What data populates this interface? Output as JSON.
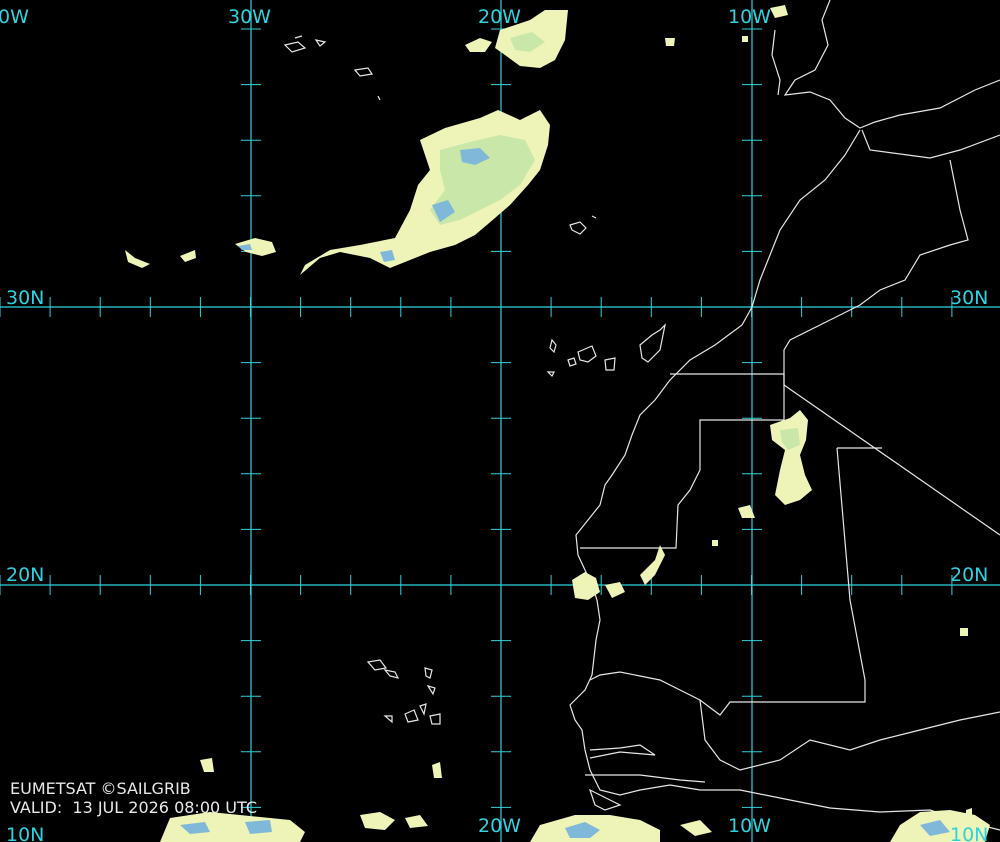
{
  "map": {
    "longitude_labels": {
      "w40_top": "0W",
      "w30_top": "30W",
      "w20_top": "20W",
      "w10_top": "10W",
      "w20_bottom": "20W",
      "w10_bottom": "10W"
    },
    "latitude_labels": {
      "n30_left": "30N",
      "n30_right": "30N",
      "n20_left": "20N",
      "n20_right": "20N",
      "n10_left": "10N",
      "n10_right": "10N"
    },
    "credit": "EUMETSAT ©SAILGRIB",
    "valid_label": "VALID:",
    "valid_time": "13 JUL 2026 08:00 UTC"
  },
  "colors": {
    "grid": "#2fd3e0",
    "coast": "#e6e6e6",
    "cloud_light": "#eef3b8",
    "cloud_mid": "#c9e7a8",
    "cloud_dense": "#7fb8d8"
  }
}
